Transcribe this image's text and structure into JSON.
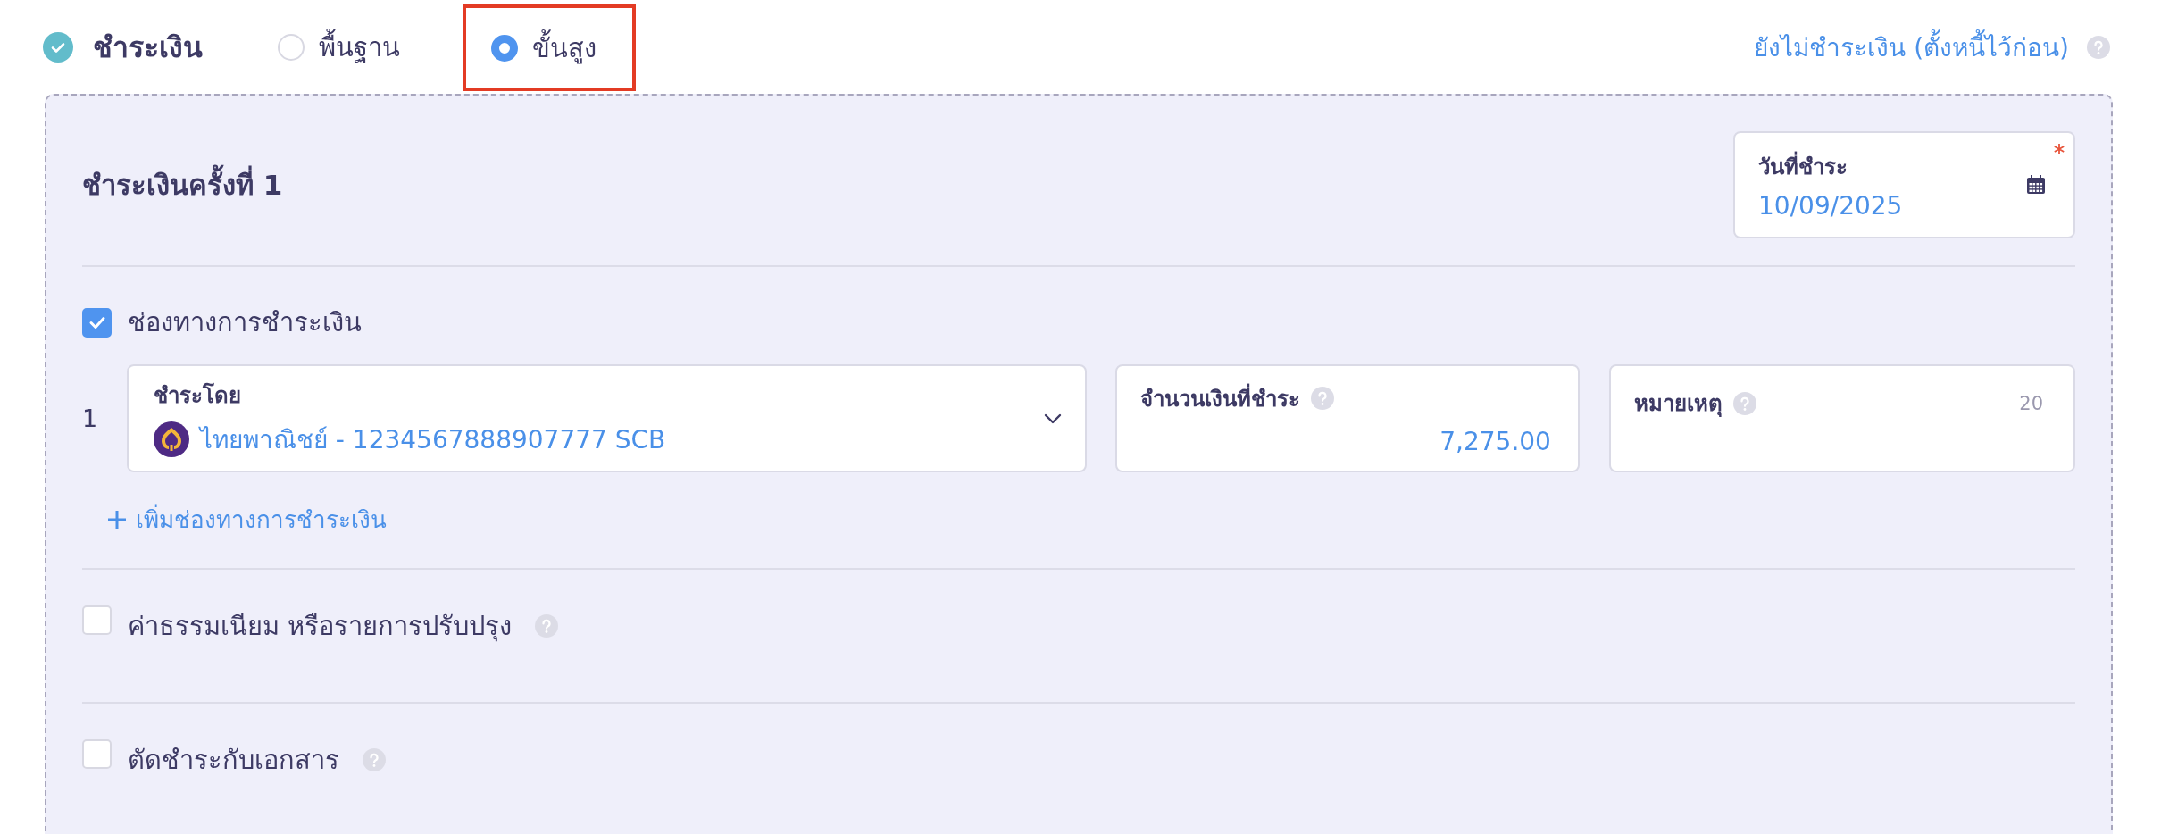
{
  "section": {
    "title": "ชำระเงิน",
    "done": true
  },
  "mode_options": [
    {
      "label": "พื้นฐาน",
      "selected": false,
      "highlighted": false
    },
    {
      "label": "ขั้นสูง",
      "selected": true,
      "highlighted": true
    }
  ],
  "defer_link": "ยังไม่ชำระเงิน (ตั้งหนี้ไว้ก่อน)",
  "installment": {
    "title": "ชำระเงินครั้งที่ 1",
    "date_field": {
      "label": "วันที่ชำระ",
      "value": "10/09/2025",
      "required": true
    }
  },
  "payment_channels": {
    "label": "ช่องทางการชำระเงิน",
    "checked": true,
    "rows": [
      {
        "number": "1",
        "pay_by": {
          "label": "ชำระโดย",
          "value": "ไทยพาณิชย์ - 1234567888907777 SCB"
        },
        "amount": {
          "label": "จำนวนเงินที่ชำระ",
          "value": "7,275.00"
        },
        "note": {
          "label": "หมายเหตุ",
          "counter": "20"
        }
      }
    ],
    "add_link": "เพิ่มช่องทางการชำระเงิน"
  },
  "options": [
    {
      "label": "ค่าธรรมเนียม หรือรายการปรับปรุง",
      "checked": false
    },
    {
      "label": "ตัดชำระกับเอกสาร",
      "checked": false
    }
  ]
}
